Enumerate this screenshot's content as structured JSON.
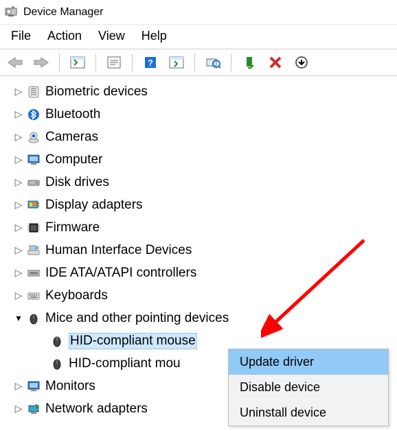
{
  "title": "Device Manager",
  "menu": {
    "file": "File",
    "action": "Action",
    "view": "View",
    "help": "Help"
  },
  "tree": {
    "biometric": "Biometric devices",
    "bluetooth": "Bluetooth",
    "cameras": "Cameras",
    "computer": "Computer",
    "disk": "Disk drives",
    "display": "Display adapters",
    "firmware": "Firmware",
    "hid": "Human Interface Devices",
    "ide": "IDE ATA/ATAPI controllers",
    "keyboards": "Keyboards",
    "mice": "Mice and other pointing devices",
    "mice_child_1": "HID-compliant mouse",
    "mice_child_2": "HID-compliant mou",
    "monitors": "Monitors",
    "network": "Network adapters"
  },
  "context_menu": {
    "update": "Update driver",
    "disable": "Disable device",
    "uninstall": "Uninstall device"
  }
}
